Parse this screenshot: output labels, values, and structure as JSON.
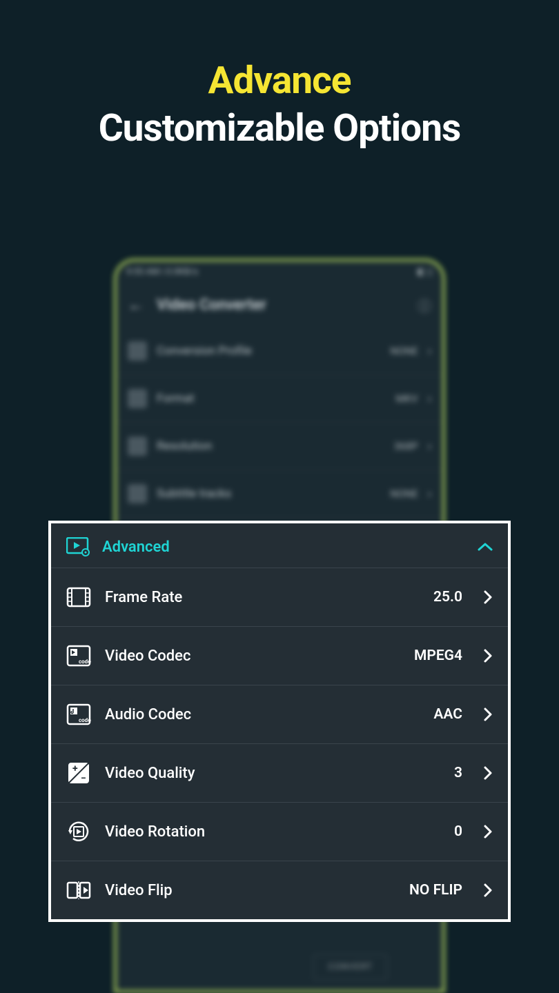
{
  "promo": {
    "line1": "Advance",
    "line2": "Customizable Options"
  },
  "phone": {
    "status_left": "9:55 AM | 0.0KB/s",
    "app_title": "Video Converter",
    "rows": [
      {
        "label": "Conversion Profile",
        "value": "NONE"
      },
      {
        "label": "Format",
        "value": "MKV"
      },
      {
        "label": "Resolution",
        "value": "368P"
      },
      {
        "label": "Subtitle tracks",
        "value": "NONE"
      }
    ],
    "convert": "CONVERT"
  },
  "advanced": {
    "header": "Advanced",
    "rows": [
      {
        "icon": "film-icon",
        "label": "Frame Rate",
        "value": "25.0"
      },
      {
        "icon": "video-codec-icon",
        "label": "Video Codec",
        "value": "MPEG4"
      },
      {
        "icon": "audio-codec-icon",
        "label": "Audio Codec",
        "value": "AAC"
      },
      {
        "icon": "quality-icon",
        "label": "Video Quality",
        "value": "3"
      },
      {
        "icon": "rotation-icon",
        "label": "Video Rotation",
        "value": "0"
      },
      {
        "icon": "flip-icon",
        "label": "Video Flip",
        "value": "NO FLIP"
      }
    ]
  }
}
